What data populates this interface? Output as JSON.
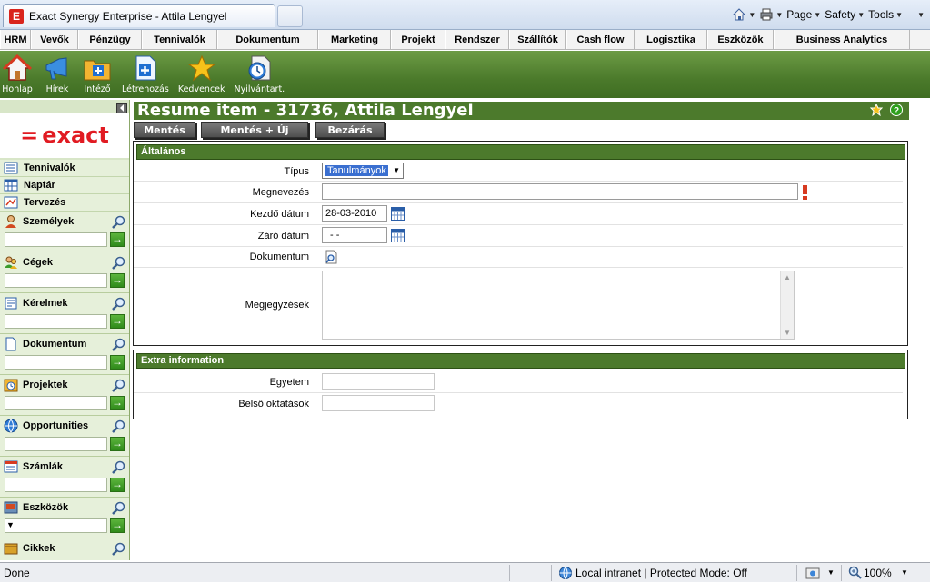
{
  "browser": {
    "tab_title": "Exact Synergy Enterprise - Attila Lengyel",
    "commands": {
      "page": "Page",
      "safety": "Safety",
      "tools": "Tools"
    }
  },
  "menu": [
    {
      "label": "HRM",
      "w": 34
    },
    {
      "label": "Vevők",
      "w": 52
    },
    {
      "label": "Pénzügy",
      "w": 70
    },
    {
      "label": "Tennivalók",
      "w": 83
    },
    {
      "label": "Dokumentum",
      "w": 111
    },
    {
      "label": "Marketing",
      "w": 80
    },
    {
      "label": "Projekt",
      "w": 60
    },
    {
      "label": "Rendszer",
      "w": 70
    },
    {
      "label": "Szállítók",
      "w": 63
    },
    {
      "label": "Cash flow",
      "w": 75
    },
    {
      "label": "Logisztika",
      "w": 80
    },
    {
      "label": "Eszközök",
      "w": 73
    },
    {
      "label": "Business Analytics",
      "w": 150
    }
  ],
  "toolbar": {
    "home": "Honlap",
    "news": "Hírek",
    "manager": "Intéző",
    "create": "Létrehozás",
    "favorites": "Kedvencek",
    "register": "Nyilvántart."
  },
  "sidebar": {
    "logo": "exact",
    "links": {
      "todo": "Tennivalók",
      "calendar": "Naptár",
      "planning": "Tervezés"
    },
    "sections": {
      "people": "Személyek",
      "companies": "Cégek",
      "requests": "Kérelmek",
      "documents": "Dokumentum",
      "projects": "Projektek",
      "opportunities": "Opportunities",
      "invoices": "Számlák",
      "assets": "Eszközök",
      "items": "Cikkek"
    }
  },
  "page": {
    "title": "Resume item - 31736, Attila Lengyel",
    "buttons": {
      "save": "Mentés",
      "save_new": "Mentés + Új",
      "close": "Bezárás"
    }
  },
  "general": {
    "header": "Általános",
    "type_label": "Típus",
    "type_value": "Tanulmányok",
    "name_label": "Megnevezés",
    "name_value": "",
    "start_label": "Kezdő dátum",
    "start_value": "28-03-2010",
    "end_label": "Záró dátum",
    "end_value": "- -",
    "document_label": "Dokumentum",
    "notes_label": "Megjegyzések",
    "notes_value": ""
  },
  "extra": {
    "header": "Extra information",
    "university_label": "Egyetem",
    "university_value": "",
    "internal_label": "Belső oktatások",
    "internal_value": ""
  },
  "status": {
    "left": "Done",
    "zone": "Local intranet | Protected Mode: Off",
    "zoom": "100%"
  }
}
